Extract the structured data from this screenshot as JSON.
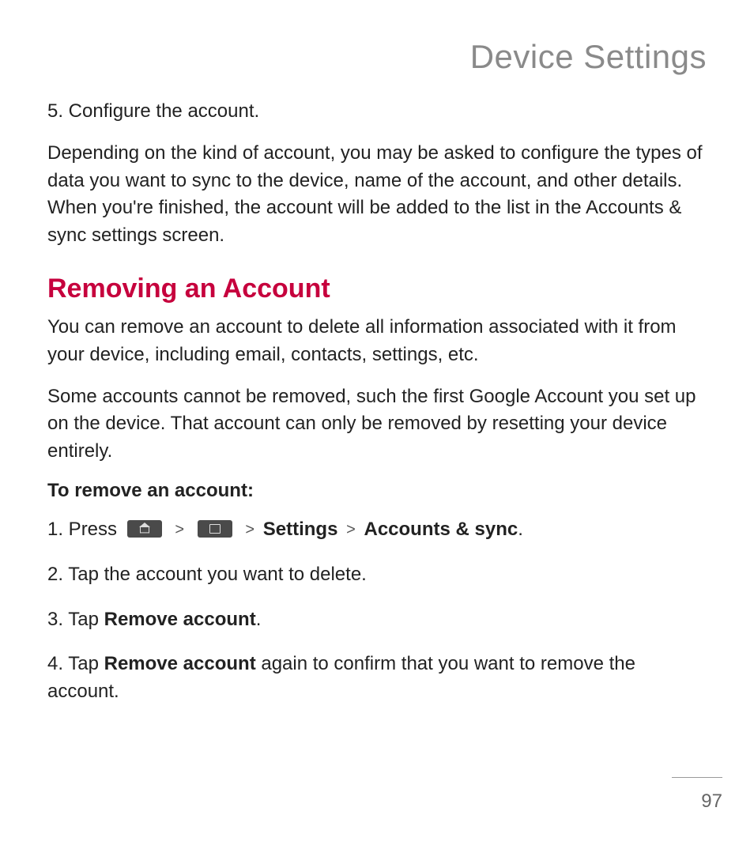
{
  "header": {
    "title": "Device Settings"
  },
  "intro": {
    "step5": "5. Configure the account.",
    "paragraph": "Depending on the kind of account, you may be asked to configure the types of data you want to sync to the device, name of the account, and other details. When you're finished, the account will be added to the list in the Accounts & sync settings screen."
  },
  "section": {
    "heading": "Removing an Account",
    "p1": "You can remove an account to delete all information associated with it from your device, including email, contacts, settings, etc.",
    "p2": "Some accounts cannot be removed, such the first Google Account you set up on the device. That account can only be removed by resetting your device entirely.",
    "subheading": "To remove an account:",
    "step1_prefix": "1. Press ",
    "step1_settings": "Settings",
    "step1_accounts": "Accounts & sync",
    "step1_period": ".",
    "chevron": ">",
    "step2": "2. Tap the account you want to delete.",
    "step3_prefix": "3. Tap ",
    "step3_bold": "Remove account",
    "step3_suffix": ".",
    "step4_prefix": "4. Tap ",
    "step4_bold": "Remove account",
    "step4_suffix": " again to confirm that you want to remove the account."
  },
  "footer": {
    "page_number": "97"
  }
}
